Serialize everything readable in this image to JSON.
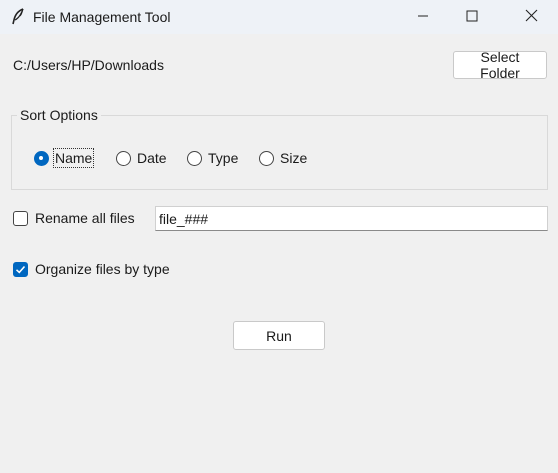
{
  "window": {
    "title": "File Management Tool",
    "icons": {
      "app": "feather-icon",
      "minimize": "minimize-icon",
      "maximize": "maximize-icon",
      "close": "close-icon"
    }
  },
  "folder": {
    "path": "C:/Users/HP/Downloads",
    "select_button": "Select Folder"
  },
  "sort": {
    "group_title": "Sort Options",
    "options": [
      "Name",
      "Date",
      "Type",
      "Size"
    ],
    "selected": "Name"
  },
  "rename": {
    "label": "Rename all files",
    "checked": false,
    "pattern_value": "file_###"
  },
  "organize": {
    "label": "Organize files by type",
    "checked": true
  },
  "actions": {
    "run_label": "Run"
  },
  "colors": {
    "accent": "#0067c0",
    "background": "#f0f0f0",
    "titlebar": "#eef2f7"
  }
}
